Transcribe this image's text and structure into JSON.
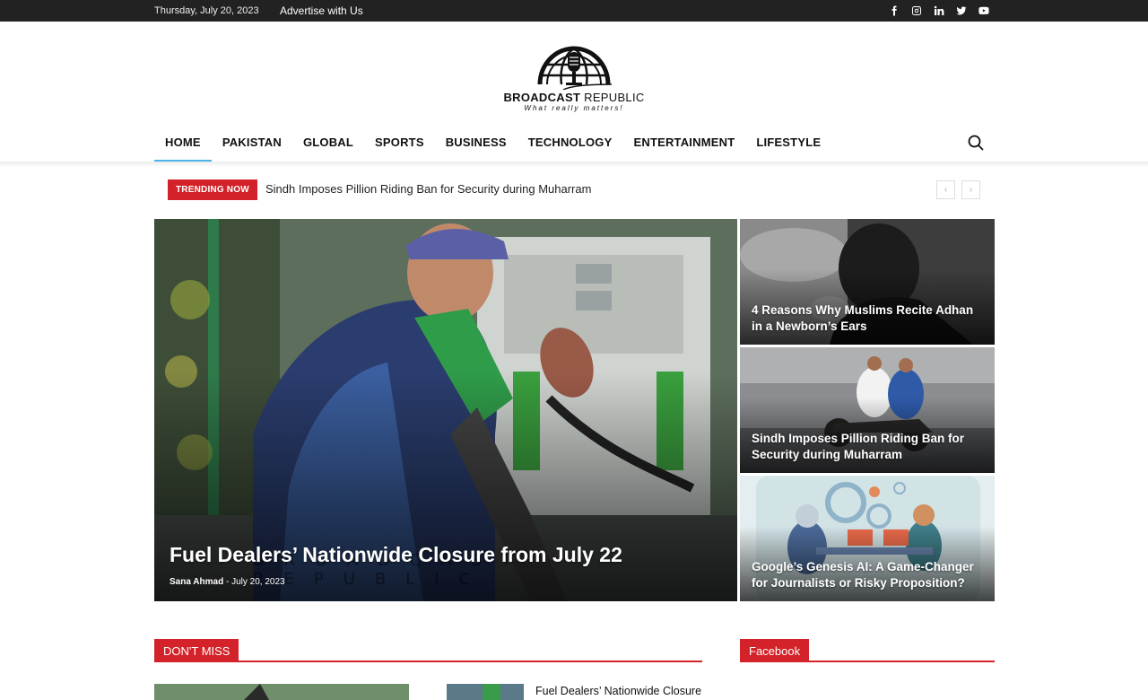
{
  "topbar": {
    "date": "Thursday, July 20, 2023",
    "advertise": "Advertise with Us",
    "social": [
      "facebook-icon",
      "instagram-icon",
      "linkedin-icon",
      "twitter-icon",
      "youtube-icon"
    ]
  },
  "logo": {
    "brand_bold": "BROADCAST",
    "brand_light": "REPUBLIC",
    "tagline": "What really matters!"
  },
  "nav": {
    "items": [
      "HOME",
      "PAKISTAN",
      "GLOBAL",
      "SPORTS",
      "BUSINESS",
      "TECHNOLOGY",
      "ENTERTAINMENT",
      "LIFESTYLE"
    ],
    "active": "HOME"
  },
  "trending": {
    "label": "TRENDING NOW",
    "headline": "Sindh Imposes Pillion Riding Ban for Security during Muharram",
    "prev": "‹",
    "next": "›"
  },
  "featured": {
    "main": {
      "title": "Fuel Dealers’ Nationwide Closure from July 22",
      "author": "Sana Ahmad",
      "separator": "-",
      "date": "July 20, 2023",
      "watermark": "BROADCAST REPUBLIC"
    },
    "side": [
      {
        "title": "4 Reasons Why Muslims Recite Adhan in a Newborn’s Ears"
      },
      {
        "title": "Sindh Imposes Pillion Riding Ban for Security during Muharram"
      },
      {
        "title": "Google’s Genesis AI: A Game-Changer for Journalists or Risky Proposition?"
      }
    ]
  },
  "sections": {
    "dont_miss": "DON'T MISS",
    "facebook": "Facebook",
    "dont_miss_side_title": "Fuel Dealers’ Nationwide Closure"
  },
  "colors": {
    "accent": "#d32229",
    "topbar": "#222222",
    "nav_active": "#4db2ec"
  }
}
